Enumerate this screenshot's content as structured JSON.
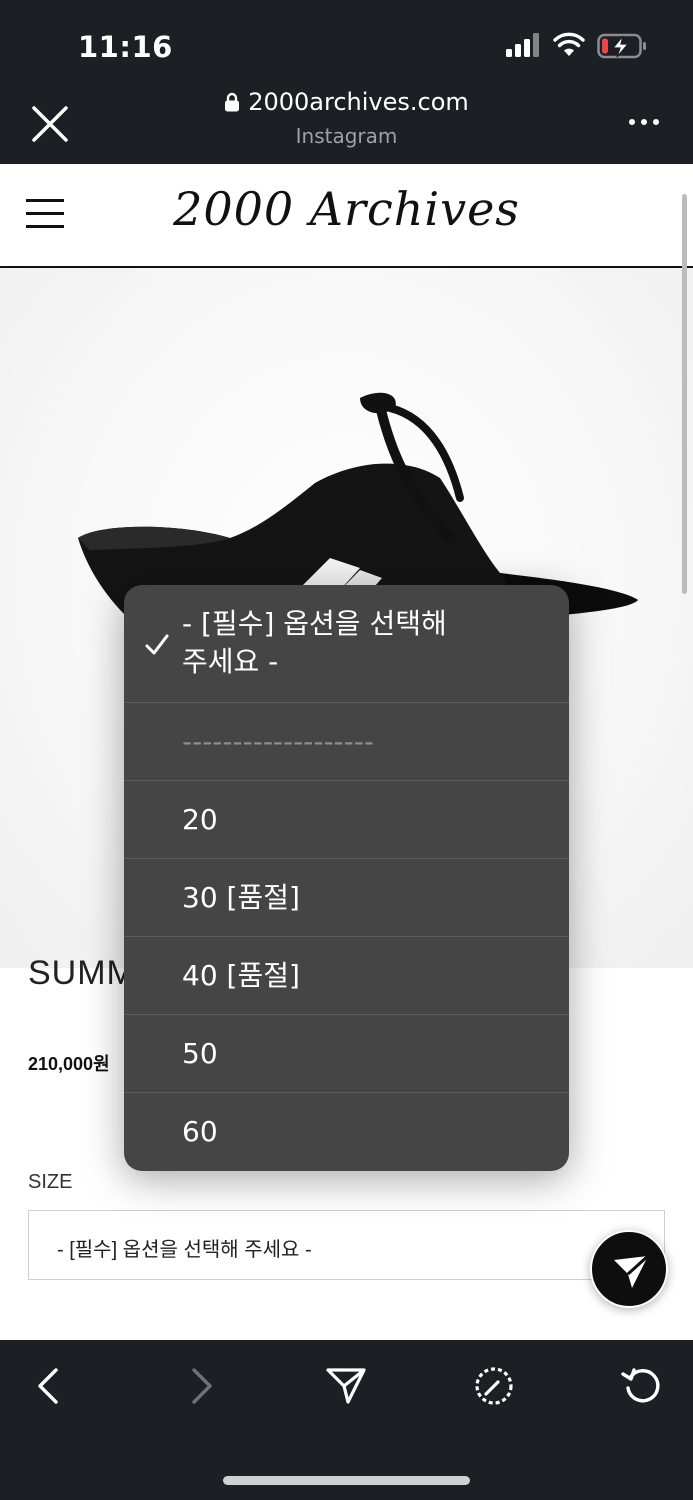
{
  "status": {
    "time": "11:16"
  },
  "browser": {
    "domain": "2000archives.com",
    "source": "Instagram"
  },
  "site": {
    "logo": "2000 Archives"
  },
  "product": {
    "name_visible": "SUMM",
    "price": "210,000원",
    "size_label": "SIZE",
    "size_select_value": "- [필수] 옵션을 선택해 주세요 -"
  },
  "picker": {
    "options": [
      {
        "line1": "- [필수] 옵션을 선택해",
        "line2": "주세요 -",
        "selected": true
      },
      {
        "label": "-------------------",
        "disabled": true
      },
      {
        "label": "20"
      },
      {
        "label": "30 [품절]"
      },
      {
        "label": "40 [품절]"
      },
      {
        "label": "50"
      },
      {
        "label": "60"
      }
    ]
  },
  "toolbar": {
    "icons": [
      "back-icon",
      "forward-icon",
      "share-icon",
      "safari-compass-icon",
      "reload-icon"
    ]
  },
  "colors": {
    "chrome_bg": "#1c1f23",
    "picker_bg": "#454546",
    "battery_low": "#e5484d"
  }
}
